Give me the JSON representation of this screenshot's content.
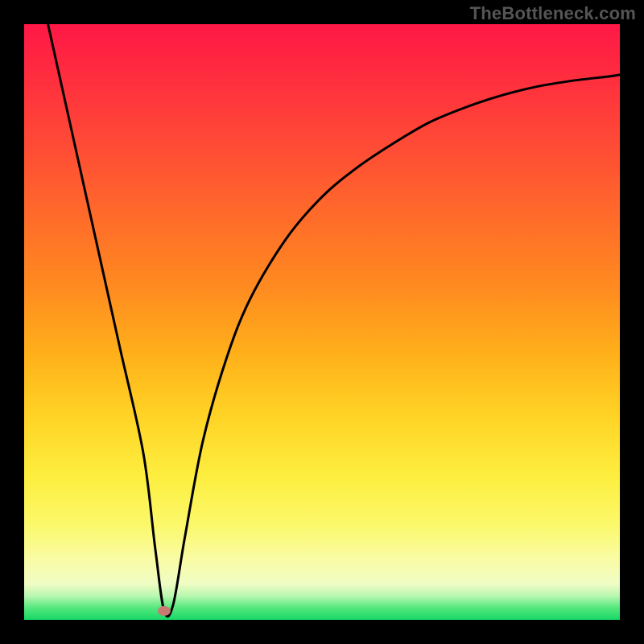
{
  "watermark": "TheBottleneck.com",
  "chart_data": {
    "type": "line",
    "title": "",
    "xlabel": "",
    "ylabel": "",
    "xlim": [
      0,
      100
    ],
    "ylim": [
      0,
      100
    ],
    "grid": false,
    "legend": false,
    "series": [
      {
        "name": "curve",
        "x": [
          4,
          8,
          12,
          16,
          20,
          22,
          23.5,
          25,
          27,
          30,
          34,
          38,
          44,
          50,
          56,
          62,
          68,
          74,
          80,
          86,
          92,
          98,
          100
        ],
        "y": [
          100,
          82,
          64,
          46,
          28,
          12,
          1.5,
          2.5,
          14,
          30,
          44,
          54,
          64,
          71,
          76,
          80,
          83.5,
          86,
          88,
          89.5,
          90.5,
          91.2,
          91.5
        ]
      }
    ],
    "annotations": [
      {
        "name": "marker",
        "x": 23.5,
        "y": 1.5
      }
    ]
  }
}
